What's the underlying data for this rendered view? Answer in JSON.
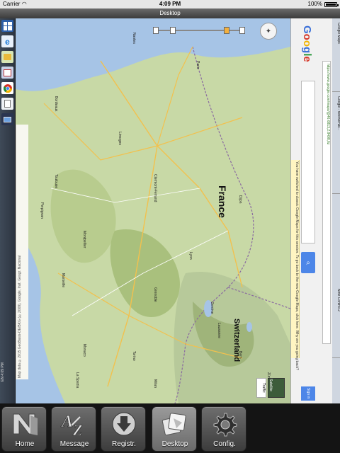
{
  "status_bar": {
    "carrier": "Carrier",
    "time": "4:09 PM",
    "battery": "100%"
  },
  "title_bar": {
    "title": "Desktop"
  },
  "taskbar": {
    "tray_items": [
      "EN",
      "4:09 PM"
    ]
  },
  "map": {
    "country_label": "France",
    "neighbor_label": "Switzerland",
    "cities": [
      "Paris",
      "Lyon",
      "Toulouse",
      "Bordeaux",
      "Nantes",
      "Montpellier",
      "Marseille",
      "Dijon",
      "Clermont-Ferrand",
      "Limoges",
      "Grenoble",
      "Genève",
      "Torino",
      "Milan",
      "Monaco",
      "Perpignan",
      "La Spezia",
      "Bern",
      "Zürich",
      "Lausanne"
    ],
    "attribution": "Map data ©2015 GeoBasis-DE/BKG (©2009), Google, Inst. Geogr. Nacional",
    "map_type_label": "Satellite",
    "traffic_label": "Traffic"
  },
  "browser": {
    "notice": "You have switched to classic Google Maps for this session. To go back to the new Google Maps, click here. Why are you going back?",
    "url": "https://www.google.com/maps/@46.6813,2.8498,6z",
    "tabs": [
      "Google Maps",
      "Google - fletcherhat...",
      "Nine Control 2"
    ],
    "sign_in_label": "Sign in"
  },
  "tabbar": {
    "items": [
      {
        "label": "Home",
        "active": false
      },
      {
        "label": "Message",
        "active": false
      },
      {
        "label": "Registr.",
        "active": false
      },
      {
        "label": "Desktop",
        "active": true
      },
      {
        "label": "Config.",
        "active": false
      }
    ]
  }
}
